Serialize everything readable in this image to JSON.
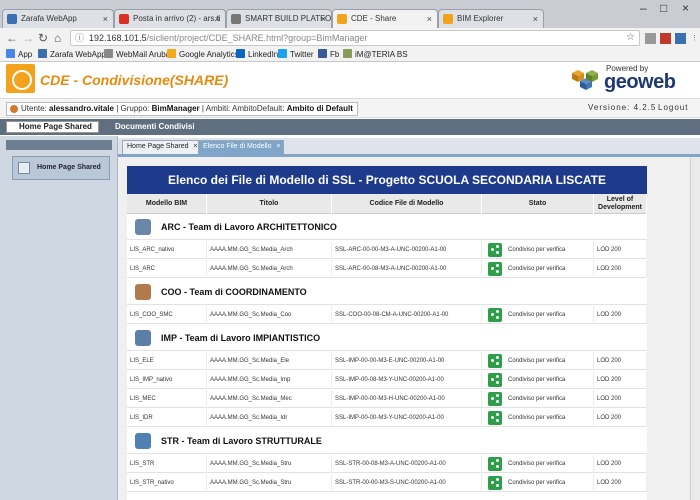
{
  "browser": {
    "tabs": [
      {
        "label": "Zarafa WebApp",
        "favicon_color": "#3a6fb0"
      },
      {
        "label": "Posta in arrivo (2) - ars.ti",
        "favicon_color": "#d93025"
      },
      {
        "label": "SMART BUILD PLATFORM",
        "favicon_color": "#777777"
      },
      {
        "label": "CDE - Share",
        "favicon_color": "#f3a21b"
      },
      {
        "label": "BIM Explorer",
        "favicon_color": "#f3a21b"
      }
    ],
    "url_host": "192.168.101.5",
    "url_path": "/siclient/project/CDE_SHARE.html?group=BimManager",
    "bookmarks": [
      {
        "label": "App",
        "color": "#4a86e8"
      },
      {
        "label": "Zarafa WebApp",
        "color": "#3a6fb0"
      },
      {
        "label": "WebMail Aruba",
        "color": "#888888"
      },
      {
        "label": "Google Analytics",
        "color": "#f4a81d"
      },
      {
        "label": "LinkedIn",
        "color": "#0a66c2"
      },
      {
        "label": "Twitter",
        "color": "#1da1f2"
      },
      {
        "label": "Fb",
        "color": "#3b5998"
      },
      {
        "label": "iM@TERIA BS",
        "color": "#8a9a5b"
      }
    ]
  },
  "app": {
    "title": "CDE - Condivisione(SHARE)",
    "powered_by": "Powered by",
    "brand": "geoweb",
    "user_prefix": "Utente:",
    "user_name": "alessandro.vitale",
    "group_prefix": "| Gruppo:",
    "group_name": "BimManager",
    "ambito_prefix": "| Ambiti: AmbitoDefault:",
    "ambito_name": "Ambito di Default",
    "version": "Versione: 4.2.5",
    "logout": "Logout",
    "menu_home": "Home Page Shared",
    "menu_docs": "Documenti Condivisi",
    "sidebar_item": "Home Page Shared",
    "content_tabs": [
      "Home Page Shared",
      "Elenco File di Modello"
    ]
  },
  "panel": {
    "title": "Elenco dei File di Modello di SSL - Progetto SCUOLA SECONDARIA LISCATE",
    "columns": [
      "Modello BIM",
      "Titolo",
      "Codice File di Modello",
      "Stato",
      "Level of Development"
    ],
    "groups": [
      {
        "label": "ARC - Team di Lavoro ARCHITETTONICO",
        "icon_color": "#6a86a8",
        "rows": [
          [
            "LIS_ARC_nativo",
            "AAAA.MM.GG_Sc.Media_Arch",
            "SSL-ARC-00-00-M3-A-UNC-00200-A1-00",
            "Condiviso per verifica",
            "LOD 200"
          ],
          [
            "LIS_ARC",
            "AAAA.MM.GG_Sc.Media_Arch",
            "SSL-ARC-00-08-M3-A-UNC-00200-A1-00",
            "Condiviso per verifica",
            "LOD 200"
          ]
        ]
      },
      {
        "label": "COO - Team di COORDINAMENTO",
        "icon_color": "#b07a4a",
        "rows": [
          [
            "LIS_COO_SMC",
            "AAAA.MM.GG_Sc.Media_Coo",
            "SSL-COO-00-08-CM-A-UNC-00200-A1-00",
            "Condiviso per verifica",
            "LOD 200"
          ]
        ]
      },
      {
        "label": "IMP - Team di Lavoro IMPIANTISTICO",
        "icon_color": "#5b7fa6",
        "rows": [
          [
            "LIS_ELE",
            "AAAA.MM.GG_Sc.Media_Ele",
            "SSL-IMP-00-00-M3-E-UNC-00200-A1-00",
            "Condiviso per verifica",
            "LOD 200"
          ],
          [
            "LIS_IMP_nativo",
            "AAAA.MM.GG_Sc.Media_Imp",
            "SSL-IMP-00-08-M3-Y-UNC-00200-A1-00",
            "Condiviso per verifica",
            "LOD 200"
          ],
          [
            "LIS_MEC",
            "AAAA.MM.GG_Sc.Media_Mec",
            "SSL-IMP-00-00-M3-H-UNC-00200-A1-00",
            "Condiviso per verifica",
            "LOD 200"
          ],
          [
            "LIS_IDR",
            "AAAA.MM.GG_Sc.Media_Idr",
            "SSL-IMP-00-00-M3-Y-UNC-00200-A1-00",
            "Condiviso per verifica",
            "LOD 200"
          ]
        ]
      },
      {
        "label": "STR - Team di Lavoro STRUTTURALE",
        "icon_color": "#4f7fb3",
        "rows": [
          [
            "LIS_STR",
            "AAAA.MM.GG_Sc.Media_Stru",
            "SSL-STR-00-08-M3-A-UNC-00200-A1-00",
            "Condiviso per verifica",
            "LOD 200"
          ],
          [
            "LIS_STR_nativo",
            "AAAA.MM.GG_Sc.Media_Stru",
            "SSL-STR-00-00-M3-S-UNC-00200-A1-00",
            "Condiviso per verifica",
            "LOD 200"
          ]
        ]
      }
    ]
  }
}
